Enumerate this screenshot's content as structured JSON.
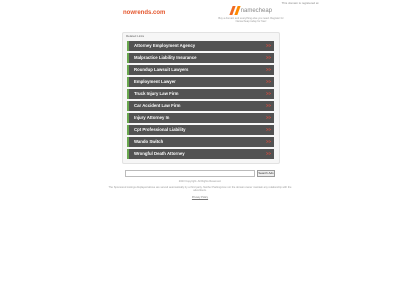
{
  "top_note": "This domain is registered at",
  "domain": "nowrends.com",
  "logo": {
    "word": "namecheap",
    "tagline": "Buy a domain and everything else you need. Register for Namecheap today for free!"
  },
  "related_label": "Related Links",
  "links": [
    {
      "label": "Attorney Employment Agency",
      "arrow": ">>"
    },
    {
      "label": "Malpractice Liability Insurance",
      "arrow": ">>"
    },
    {
      "label": "Roundup Lawsuit Lawyers",
      "arrow": ">>"
    },
    {
      "label": "Employment Lawyer",
      "arrow": ">>"
    },
    {
      "label": "Truck Injury Law Firm",
      "arrow": ">>"
    },
    {
      "label": "Car Accident Law Firm",
      "arrow": ">>"
    },
    {
      "label": "Injury Attorney In",
      "arrow": ">>"
    },
    {
      "label": "Cpt Professional Liability",
      "arrow": ">>"
    },
    {
      "label": "Wando Switch",
      "arrow": ">>"
    },
    {
      "label": "Wrongful Death Attorney",
      "arrow": ">>"
    }
  ],
  "search": {
    "placeholder": "",
    "button": "Search Ads"
  },
  "copyright": "2023 Copyright. All Rights Reserved.",
  "disclaimer": "The Sponsored Listings displayed above are served automatically by a third party. Neither Parkingcrew nor the domain owner maintain any relationship with the advertisers.",
  "privacy": "Privacy Policy",
  "colors": {
    "accent": "#e4572e",
    "row_bg": "#525252",
    "row_border": "#6aa84f",
    "arrow": "#e74c3c"
  }
}
